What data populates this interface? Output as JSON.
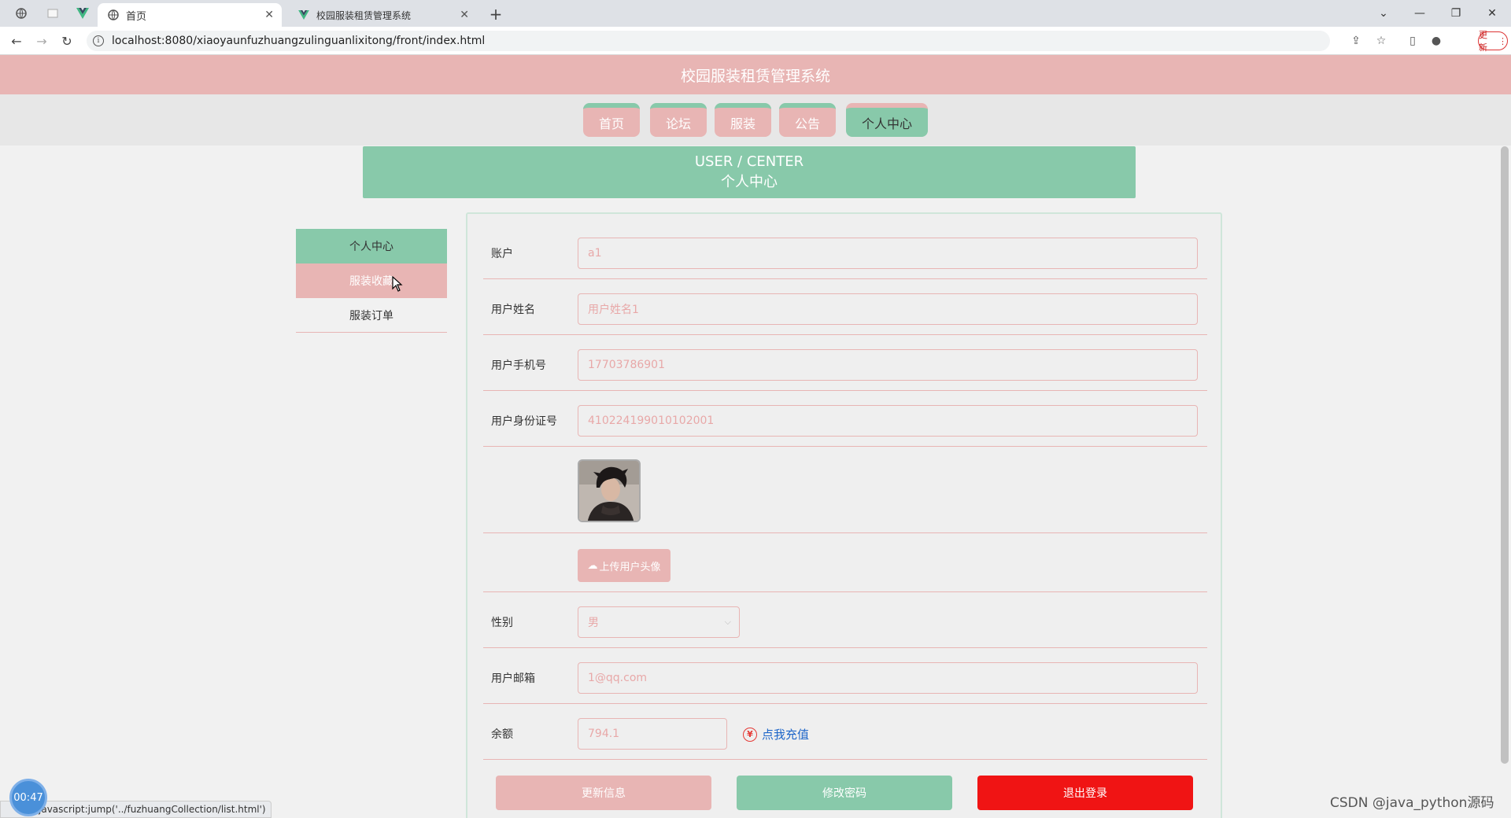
{
  "browser": {
    "tabs": [
      {
        "title": "首页",
        "active": true
      },
      {
        "title": "校园服装租赁管理系统",
        "active": false
      }
    ],
    "url": "localhost:8080/xiaoyaunfuzhuangzulinguanlixitong/front/index.html",
    "update_label": "更新",
    "status_url": "javascript:jump('../fuzhuangCollection/list.html')"
  },
  "site": {
    "title": "校园服装租赁管理系统",
    "nav": [
      {
        "label": "首页",
        "active": false
      },
      {
        "label": "论坛",
        "active": false
      },
      {
        "label": "服装",
        "active": false
      },
      {
        "label": "公告",
        "active": false
      },
      {
        "label": "个人中心",
        "active": true
      }
    ]
  },
  "banner": {
    "en": "USER / CENTER",
    "cn": "个人中心"
  },
  "side_menu": [
    {
      "label": "个人中心",
      "state": "active"
    },
    {
      "label": "服装收藏",
      "state": "hover"
    },
    {
      "label": "服装订单",
      "state": "normal"
    }
  ],
  "form": {
    "account": {
      "label": "账户",
      "value": "a1"
    },
    "name": {
      "label": "用户姓名",
      "value": "用户姓名1"
    },
    "phone": {
      "label": "用户手机号",
      "value": "17703786901"
    },
    "id_card": {
      "label": "用户身份证号",
      "value": "410224199010102001"
    },
    "upload_label": "上传用户头像",
    "gender": {
      "label": "性别",
      "value": "男"
    },
    "email": {
      "label": "用户邮箱",
      "value": "1@qq.com"
    },
    "balance": {
      "label": "余额",
      "value": "794.1",
      "recharge_label": "点我充值"
    }
  },
  "actions": {
    "update": "更新信息",
    "password": "修改密码",
    "logout": "退出登录"
  },
  "overlay": {
    "timer": "00:47",
    "watermark": "CSDN @java_python源码"
  },
  "colors": {
    "pink": "#e8b5b4",
    "green": "#88c9aa",
    "logout_red": "#f01414",
    "link_blue": "#1e66c9"
  }
}
